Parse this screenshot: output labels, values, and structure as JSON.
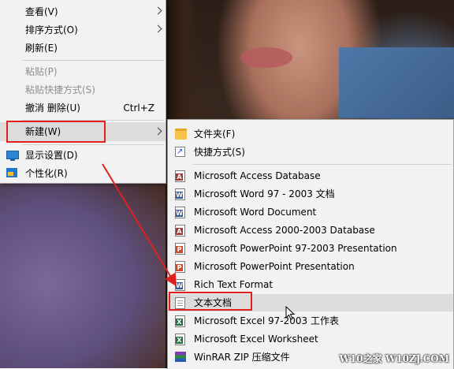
{
  "main_menu": {
    "items": [
      {
        "label": "查看(V)",
        "has_submenu": true,
        "disabled": false
      },
      {
        "label": "排序方式(O)",
        "has_submenu": true,
        "disabled": false
      },
      {
        "label": "刷新(E)",
        "has_submenu": false,
        "disabled": false
      },
      {
        "label": "粘贴(P)",
        "has_submenu": false,
        "disabled": true
      },
      {
        "label": "粘贴快捷方式(S)",
        "has_submenu": false,
        "disabled": true
      },
      {
        "label": "撤消 删除(U)",
        "shortcut": "Ctrl+Z",
        "has_submenu": false,
        "disabled": false
      },
      {
        "label": "新建(W)",
        "has_submenu": true,
        "disabled": false,
        "highlighted": true
      },
      {
        "label": "显示设置(D)",
        "icon": "display-icon",
        "disabled": false
      },
      {
        "label": "个性化(R)",
        "icon": "personalize-icon",
        "disabled": false
      }
    ]
  },
  "new_submenu": {
    "items": [
      {
        "label": "文件夹(F)",
        "icon": "folder-icon"
      },
      {
        "label": "快捷方式(S)",
        "icon": "shortcut-icon"
      },
      {
        "label": "Microsoft Access Database",
        "icon": "access-icon",
        "badge": "A"
      },
      {
        "label": "Microsoft Word 97 - 2003 文档",
        "icon": "word-icon",
        "badge": "W"
      },
      {
        "label": "Microsoft Word Document",
        "icon": "word-icon",
        "badge": "W"
      },
      {
        "label": "Microsoft Access 2000-2003 Database",
        "icon": "access-icon",
        "badge": "A"
      },
      {
        "label": "Microsoft PowerPoint 97-2003 Presentation",
        "icon": "powerpoint-icon",
        "badge": "P"
      },
      {
        "label": "Microsoft PowerPoint Presentation",
        "icon": "powerpoint-icon",
        "badge": "P"
      },
      {
        "label": "Rich Text Format",
        "icon": "rtf-icon",
        "badge": "W"
      },
      {
        "label": "文本文档",
        "icon": "text-document-icon",
        "highlighted": true
      },
      {
        "label": "Microsoft Excel 97-2003 工作表",
        "icon": "excel-icon",
        "badge": "X"
      },
      {
        "label": "Microsoft Excel Worksheet",
        "icon": "excel-icon",
        "badge": "X"
      },
      {
        "label": "WinRAR ZIP 压缩文件",
        "icon": "winrar-icon"
      }
    ]
  },
  "watermark": "W10之家 W10ZJ.COM",
  "colors": {
    "highlight_box": "#e0201e",
    "menu_bg": "#f2f2f2",
    "hover_bg": "#dcdcdc"
  }
}
